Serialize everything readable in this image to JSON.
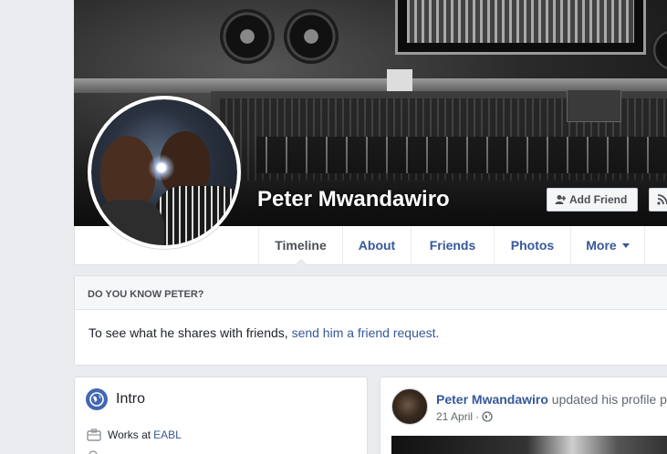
{
  "profile": {
    "name": "Peter Mwandawiro",
    "add_friend_label": "Add Friend"
  },
  "nav": {
    "tabs": [
      {
        "label": "Timeline",
        "active": true
      },
      {
        "label": "About"
      },
      {
        "label": "Friends"
      },
      {
        "label": "Photos"
      },
      {
        "label": "More"
      }
    ]
  },
  "know": {
    "header": "DO YOU KNOW PETER?",
    "text": "To see what he shares with friends, ",
    "link": "send him a friend request."
  },
  "intro": {
    "title": "Intro",
    "work_prefix": "Works at",
    "work_link": "EABL"
  },
  "post": {
    "author": "Peter Mwandawiro",
    "action": " updated his profile pi",
    "date": "21 April",
    "separator": "·"
  },
  "colors": {
    "link": "#365899",
    "brand": "#4267b2",
    "background": "#e9ebee"
  }
}
